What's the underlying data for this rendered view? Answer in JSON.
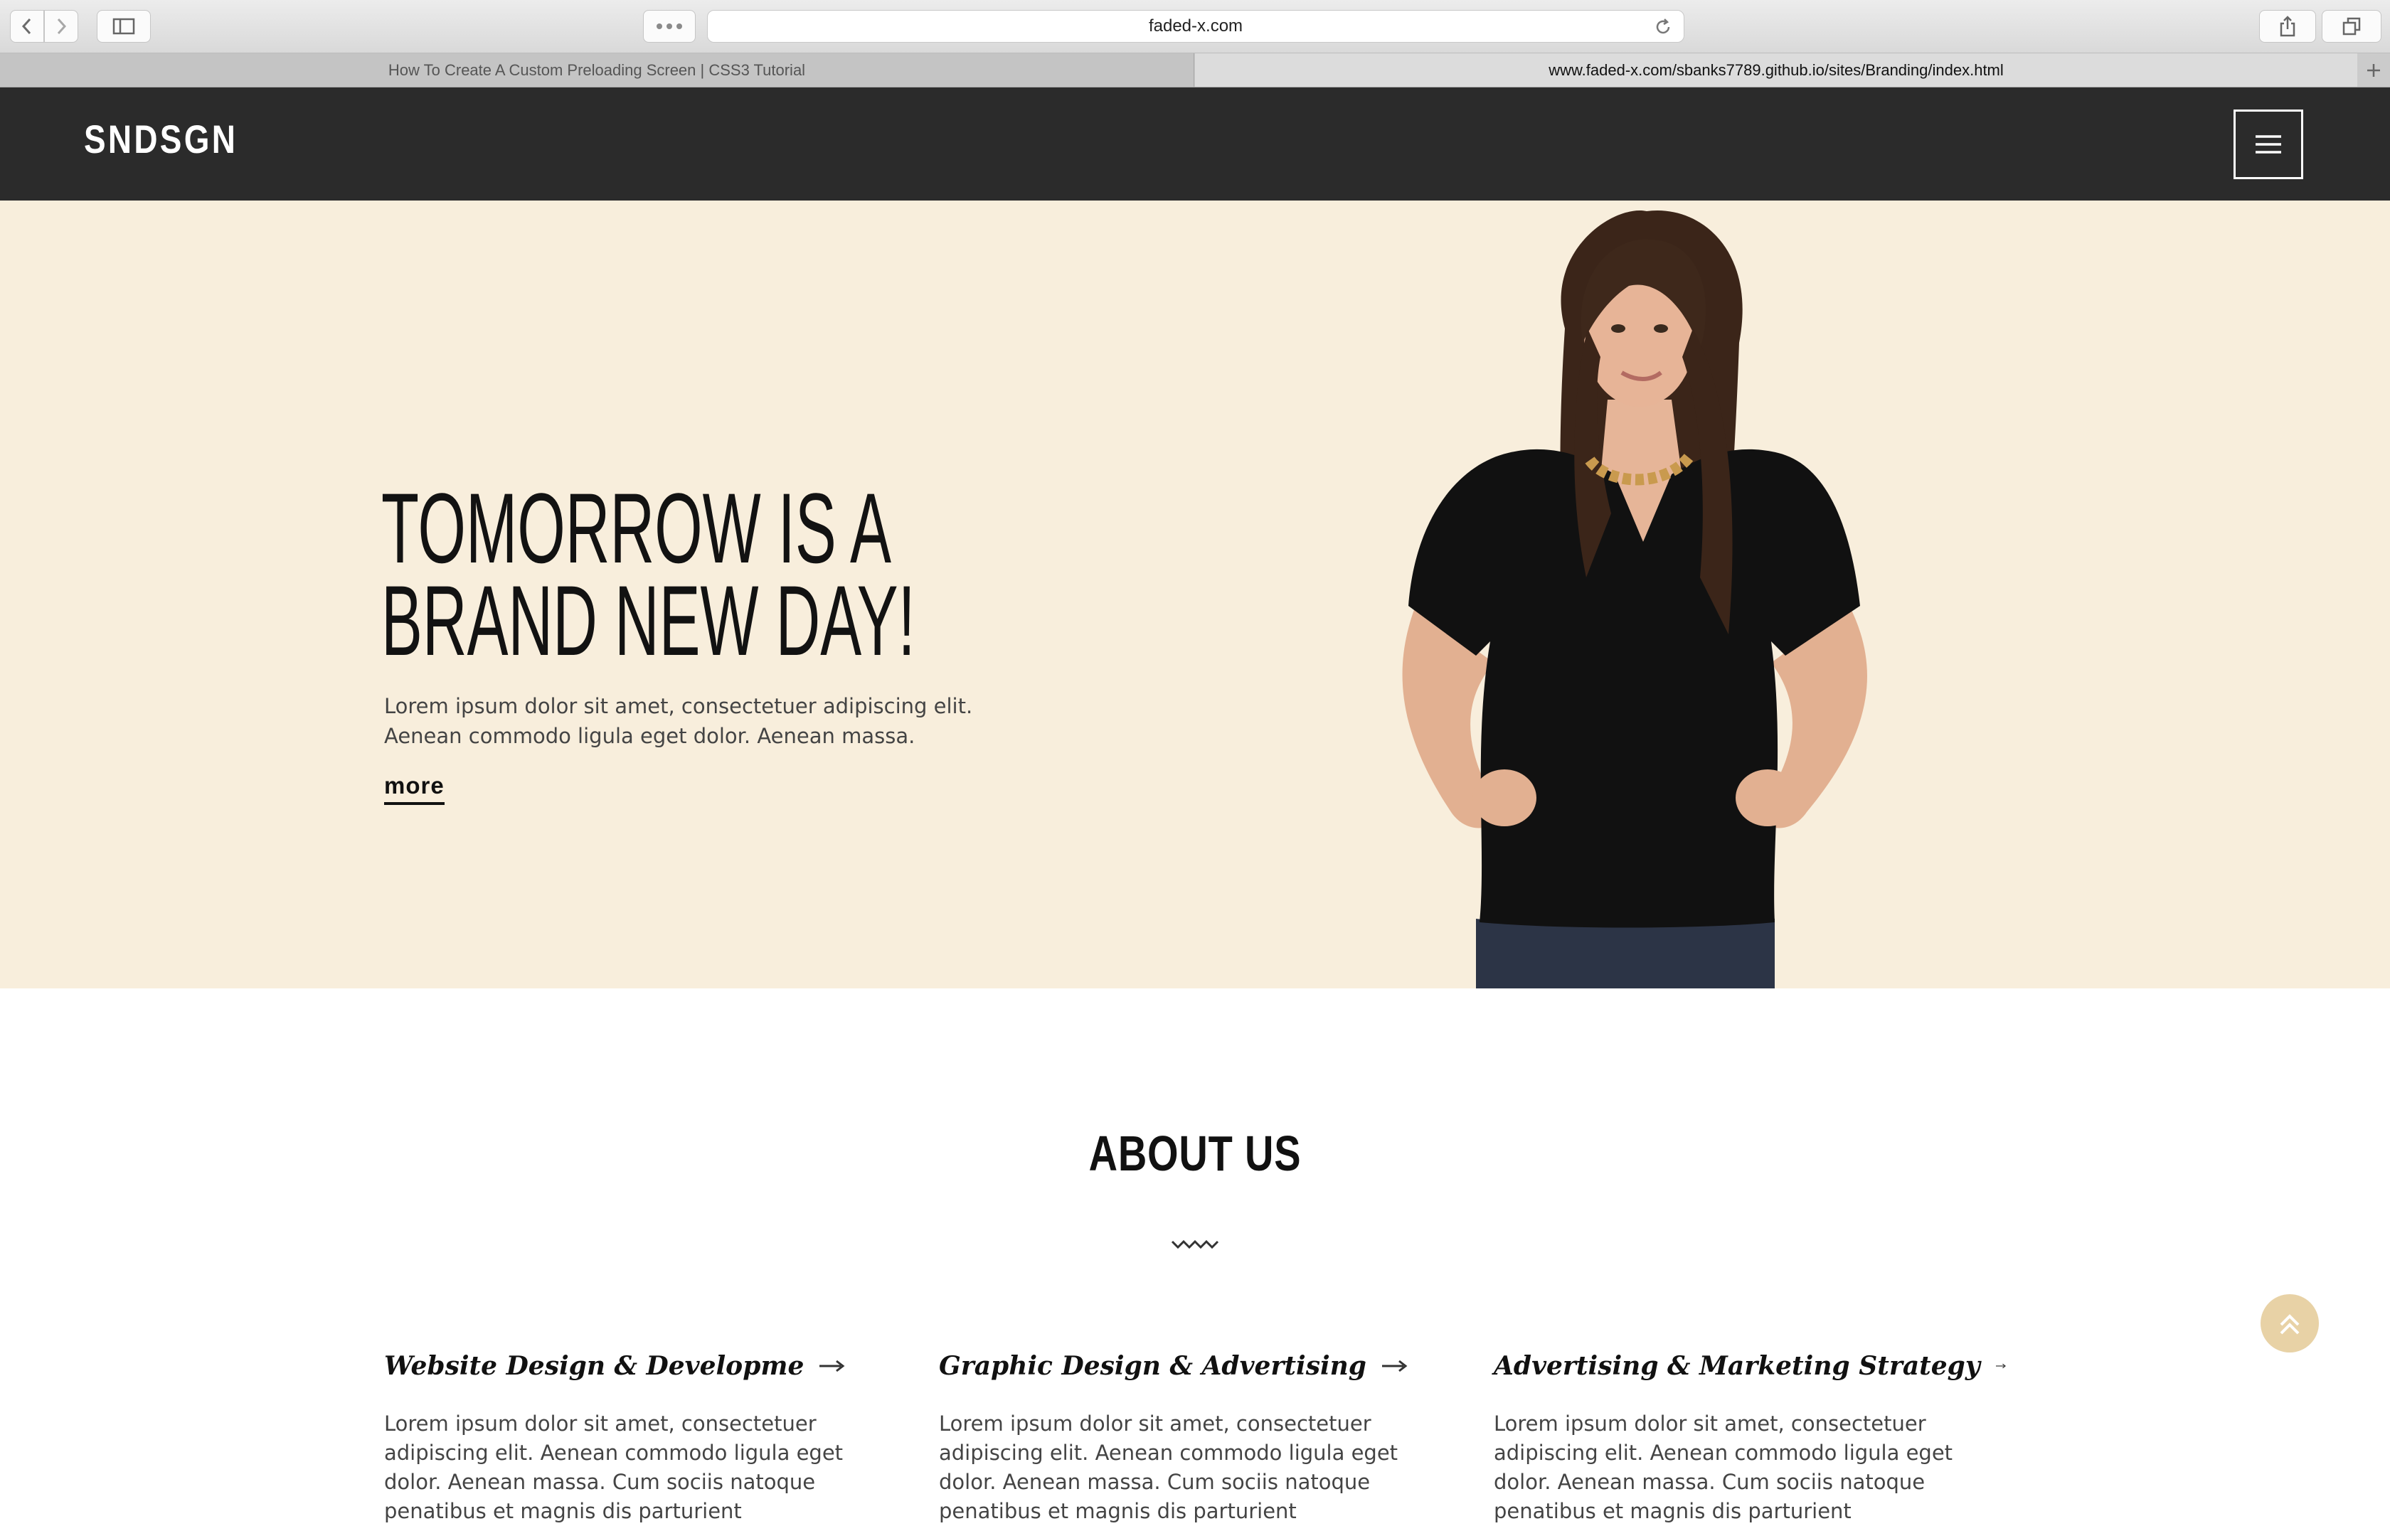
{
  "browser": {
    "url_display": "faded-x.com",
    "tabs": [
      {
        "title": "How To Create A Custom Preloading Screen | CSS3 Tutorial",
        "active": false
      },
      {
        "title": "www.faded-x.com/sbanks7789.github.io/sites/Branding/index.html",
        "active": true
      }
    ],
    "icons": [
      "back-icon",
      "forward-icon",
      "sidebar-icon",
      "more-icon",
      "reload-icon",
      "share-icon",
      "tabs-overview-icon",
      "new-tab-icon"
    ]
  },
  "site": {
    "logo": "SNDSGN",
    "menu_icon": "hamburger-icon",
    "header_color": "#2b2b2b"
  },
  "hero": {
    "title_line1": "TOMORROW IS A",
    "title_line2": "BRAND NEW DAY!",
    "text": "Lorem ipsum dolor sit amet, consectetuer adipiscing elit. Aenean commodo ligula eget dolor. Aenean massa.",
    "more_link": "more",
    "background": "#f8eedc"
  },
  "about": {
    "title": "ABOUT US",
    "divider_icon": "squiggle-icon",
    "services": [
      {
        "title": "Website Design & Developme",
        "text": "Lorem ipsum dolor sit amet, consectetuer adipiscing elit. Aenean commodo ligula eget dolor. Aenean massa. Cum sociis natoque penatibus et magnis dis parturient"
      },
      {
        "title": "Graphic Design & Advertising",
        "text": "Lorem ipsum dolor sit amet, consectetuer adipiscing elit. Aenean commodo ligula eget dolor. Aenean massa. Cum sociis natoque penatibus et magnis dis parturient"
      },
      {
        "title": "Advertising & Marketing Strategy",
        "text": "Lorem ipsum dolor sit amet, consectetuer adipiscing elit. Aenean commodo ligula eget dolor. Aenean massa. Cum sociis natoque penatibus et magnis dis parturient"
      }
    ]
  },
  "scroll_top_icon": "double-chevron-up-icon",
  "accent_color": "#e8d2a6"
}
